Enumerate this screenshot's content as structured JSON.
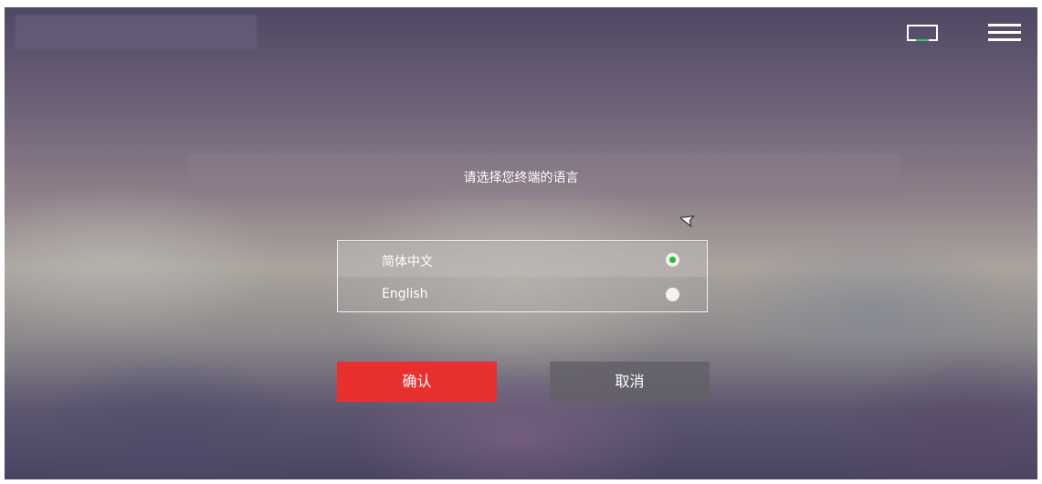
{
  "prompt": "请选择您终端的语言",
  "languages": [
    {
      "label": "简体中文",
      "selected": true
    },
    {
      "label": "English",
      "selected": false
    }
  ],
  "buttons": {
    "confirm": "确认",
    "cancel": "取消"
  },
  "icons": {
    "screen": "screen-icon",
    "menu": "hamburger-menu-icon",
    "cursor": "mouse-cursor-icon"
  },
  "colors": {
    "accent": "#e8302f",
    "radio_selected": "#22c032",
    "indicator": "#35c85a"
  }
}
